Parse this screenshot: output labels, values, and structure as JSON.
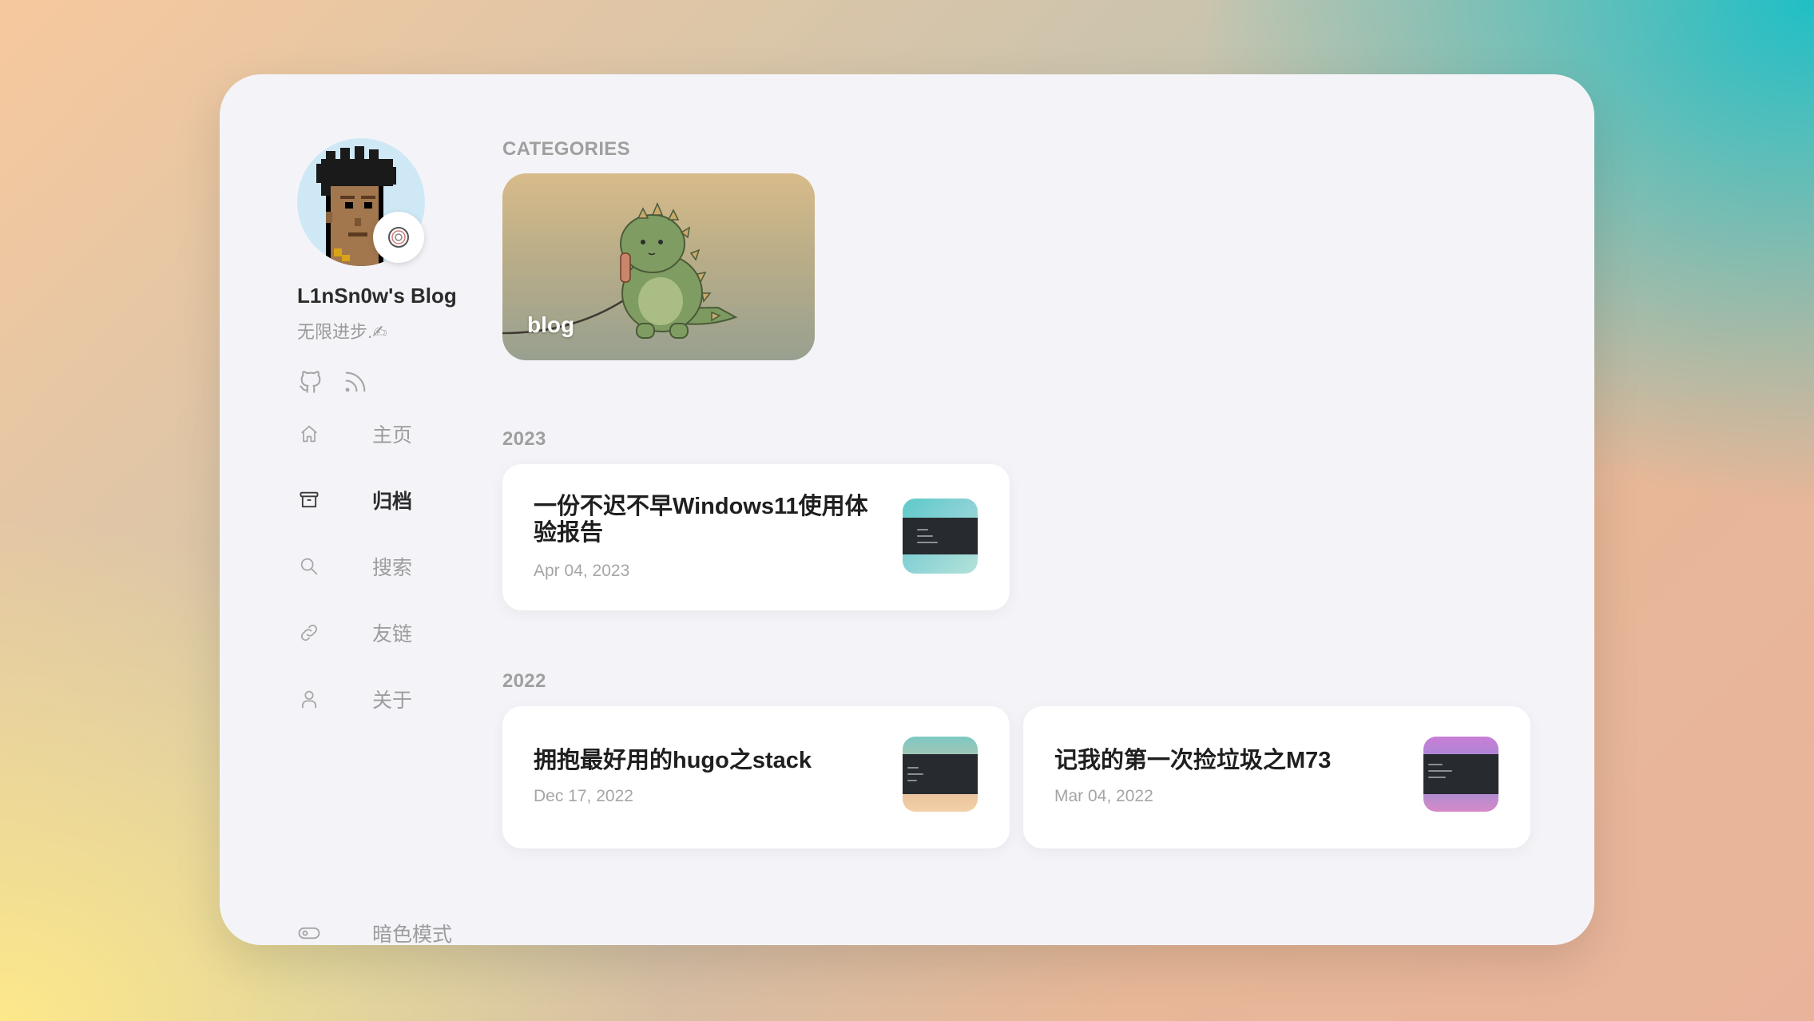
{
  "sidebar": {
    "site_title": "L1nSn0w's Blog",
    "site_desc": "无限进步.✍",
    "social": [
      {
        "icon": "github-icon"
      },
      {
        "icon": "rss-icon"
      }
    ],
    "menu": [
      {
        "label": "主页",
        "icon": "home-icon",
        "active": false
      },
      {
        "label": "归档",
        "icon": "archive-icon",
        "active": true
      },
      {
        "label": "搜索",
        "icon": "search-icon",
        "active": false
      },
      {
        "label": "友链",
        "icon": "link-icon",
        "active": false
      },
      {
        "label": "关于",
        "icon": "user-icon",
        "active": false
      }
    ],
    "dark_mode_label": "暗色模式"
  },
  "main": {
    "categories_heading": "CATEGORIES",
    "category": {
      "label": "blog"
    },
    "years": [
      {
        "year": "2023",
        "posts": [
          {
            "title": "一份不迟不早Windows11使用体验报告",
            "date": "Apr 04, 2023"
          }
        ]
      },
      {
        "year": "2022",
        "posts": [
          {
            "title": "拥抱最好用的hugo之stack",
            "date": "Dec 17, 2022"
          },
          {
            "title": "记我的第一次捡垃圾之M73",
            "date": "Mar 04, 2022"
          }
        ]
      }
    ]
  },
  "colors": {
    "window_bg": "#f4f4f8",
    "active_text": "#2b2b2b",
    "muted_text": "#9c9c9c"
  }
}
